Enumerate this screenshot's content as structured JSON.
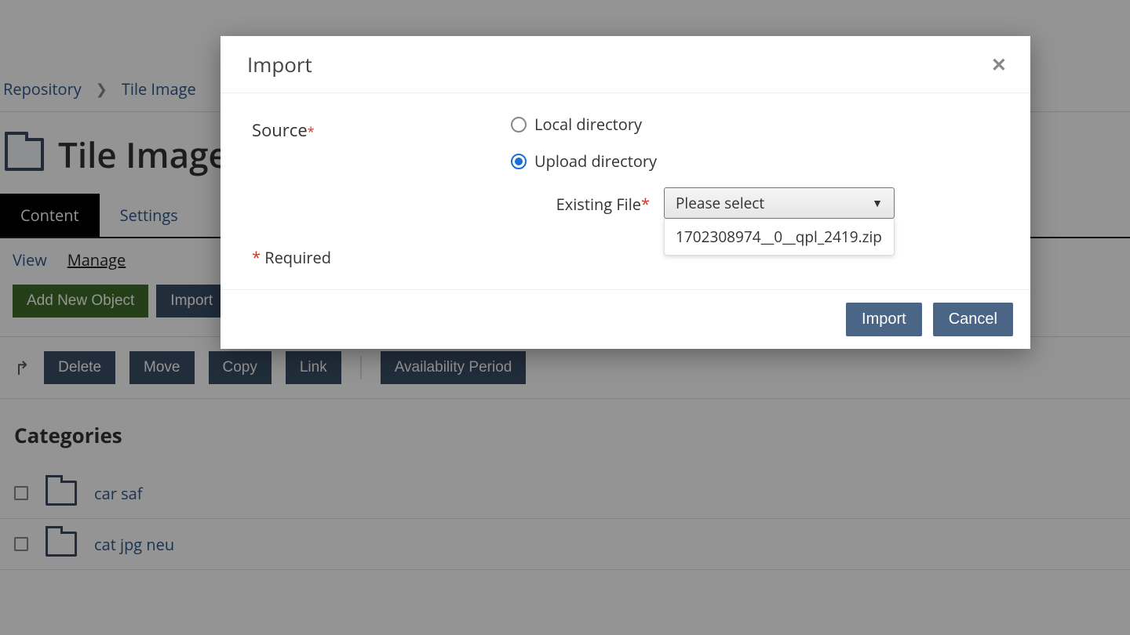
{
  "breadcrumb": {
    "root": "Repository",
    "current": "Tile Image"
  },
  "page": {
    "title": "Tile Image",
    "tabs": [
      "Content",
      "Settings"
    ],
    "active_tab": "Content",
    "subtabs": {
      "view": "View",
      "manage": "Manage"
    },
    "actions": {
      "add_new": "Add New Object",
      "import": "Import"
    },
    "bulk": {
      "delete": "Delete",
      "move": "Move",
      "copy": "Copy",
      "link": "Link",
      "availability": "Availability Period"
    },
    "categories_heading": "Categories",
    "categories": [
      {
        "name": "car saf"
      },
      {
        "name": "cat jpg neu"
      }
    ]
  },
  "modal": {
    "title": "Import",
    "source_label": "Source",
    "radio_local": "Local directory",
    "radio_upload": "Upload directory",
    "existing_file_label": "Existing File",
    "select_placeholder": "Please select",
    "dropdown_option": "1702308974__0__qpl_2419.zip",
    "required_note": "Required",
    "footer": {
      "import": "Import",
      "cancel": "Cancel"
    }
  }
}
